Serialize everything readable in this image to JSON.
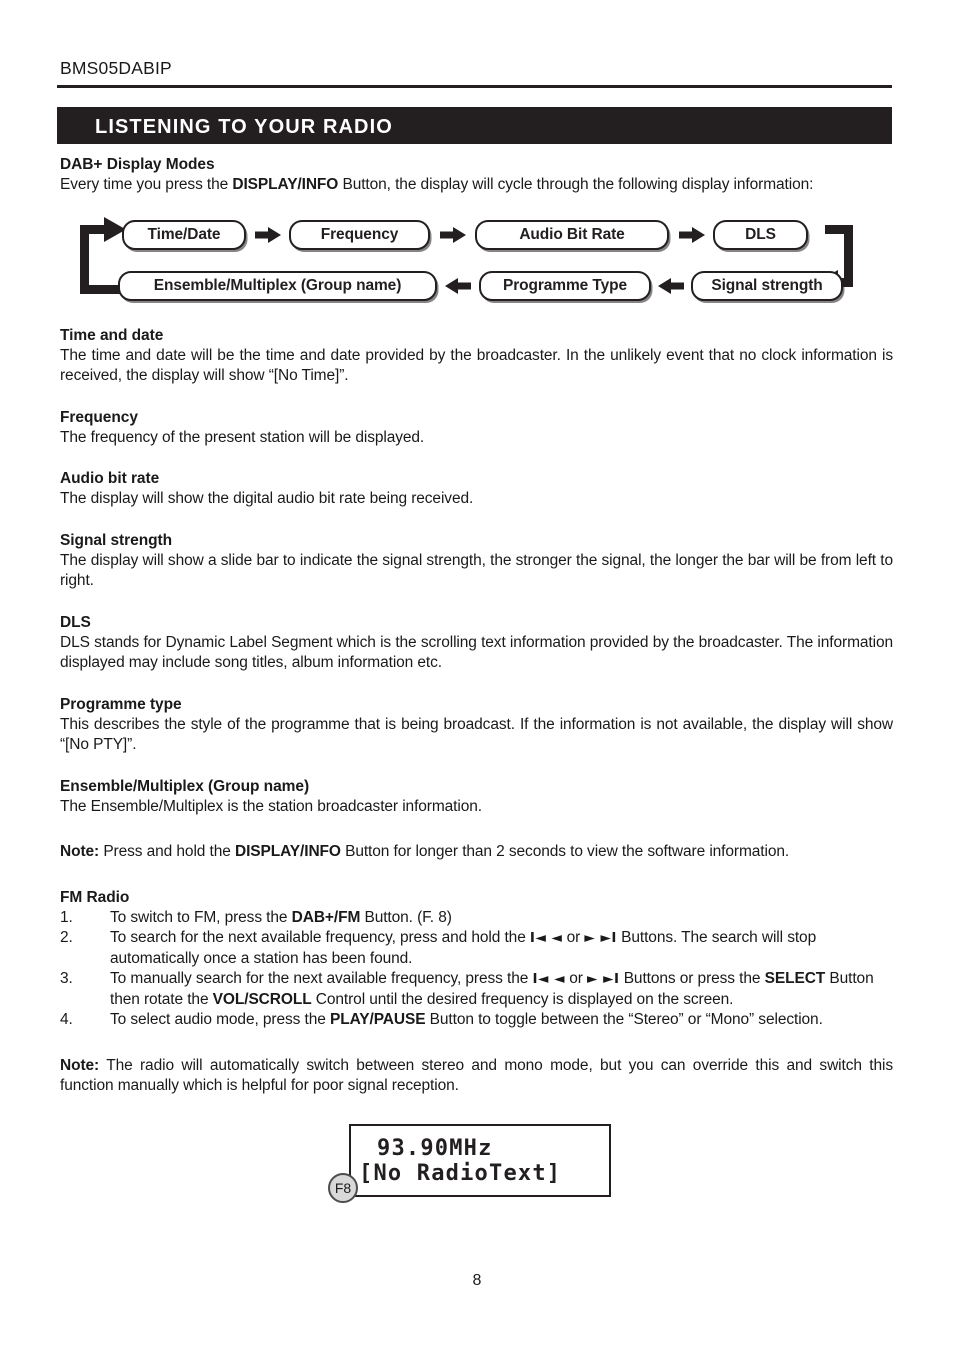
{
  "document": {
    "model_code": "BMS05DABIP",
    "page_number": "8",
    "chapter_title": "LISTENING TO YOUR RADIO"
  },
  "intro": {
    "heading": "DAB+ Display Modes",
    "text_before_bold": "Every time you press the ",
    "bold": "DISPLAY/INFO",
    "text_after_bold": " Button, the display will cycle through the following display information:"
  },
  "diagram": {
    "top_row": [
      "Time/Date",
      "Frequency",
      "Audio Bit Rate",
      "DLS"
    ],
    "bottom_row": [
      "Ensemble/Multiplex (Group name)",
      "Programme Type",
      "Signal strength"
    ]
  },
  "sections": [
    {
      "heading": "Time and date",
      "body": "The time and date will be the time and date provided by the broadcaster. In the unlikely event that no clock information is received, the display will show “[No Time]”."
    },
    {
      "heading": "Frequency",
      "body": "The frequency of the present station will be displayed."
    },
    {
      "heading": "Audio bit rate",
      "body": "The display will show the digital audio bit rate being received."
    },
    {
      "heading": "Signal strength",
      "body": "The display will show a slide bar to indicate the signal strength, the stronger the signal, the longer the bar will be from left to right."
    },
    {
      "heading": "DLS",
      "body": "DLS stands for Dynamic Label Segment which is the scrolling text information provided by the broadcaster. The information displayed may include song titles, album information etc."
    },
    {
      "heading": "Programme type",
      "body": "This describes the style of the programme that is being broadcast. If the information is not available, the display will show “[No PTY]”."
    },
    {
      "heading": "Ensemble/Multiplex (Group name)",
      "body": "The Ensemble/Multiplex is the station broadcaster information."
    }
  ],
  "note_display": {
    "label": "Note:",
    "part1": " Press and hold the ",
    "bold1": "DISPLAY/INFO",
    "part2": " Button for longer than 2 seconds to view the software information."
  },
  "fm_radio": {
    "heading": "FM Radio",
    "steps": [
      {
        "num": "1.",
        "segments": [
          {
            "t": "To switch to FM, press the ",
            "b": false
          },
          {
            "t": "DAB+/FM",
            "b": true
          },
          {
            "t": " Button. (F. 8)",
            "b": false
          }
        ]
      },
      {
        "num": "2.",
        "segments": [
          {
            "t": "To search for the next available frequency, press and hold the ",
            "b": false
          },
          {
            "t": "I◄ ◄",
            "b": true,
            "glyph": true
          },
          {
            "t": " or ",
            "b": false
          },
          {
            "t": "► ►I",
            "b": true,
            "glyph": true
          },
          {
            "t": " Buttons. The search will stop automatically once a station has been found.",
            "b": false
          }
        ]
      },
      {
        "num": "3.",
        "segments": [
          {
            "t": "To manually search for the next available frequency, press the ",
            "b": false
          },
          {
            "t": "I◄ ◄",
            "b": true,
            "glyph": true
          },
          {
            "t": " or ",
            "b": false
          },
          {
            "t": "► ►I",
            "b": true,
            "glyph": true
          },
          {
            "t": " Buttons or press the ",
            "b": false
          },
          {
            "t": "SELECT",
            "b": true
          },
          {
            "t": " Button then rotate the ",
            "b": false
          },
          {
            "t": "VOL/SCROLL",
            "b": true
          },
          {
            "t": " Control until the desired frequency is displayed on the screen.",
            "b": false
          }
        ]
      },
      {
        "num": "4.",
        "segments": [
          {
            "t": "To select audio mode, press the ",
            "b": false
          },
          {
            "t": "PLAY/PAUSE",
            "b": true
          },
          {
            "t": " Button to toggle between the “Stereo” or “Mono” selection.",
            "b": false
          }
        ]
      }
    ]
  },
  "note_stereo": {
    "label": "Note:",
    "text": "  The radio will automatically switch between stereo and mono mode, but you can override this and switch this function manually which is helpful for poor signal reception."
  },
  "figure": {
    "label": "F8",
    "lcd_line1": "93.90MHz",
    "lcd_line2": "[No RadioText]"
  },
  "colors": {
    "ink": "#231f20",
    "paper": "#ffffff",
    "label_fill": "#d9d9d9"
  }
}
